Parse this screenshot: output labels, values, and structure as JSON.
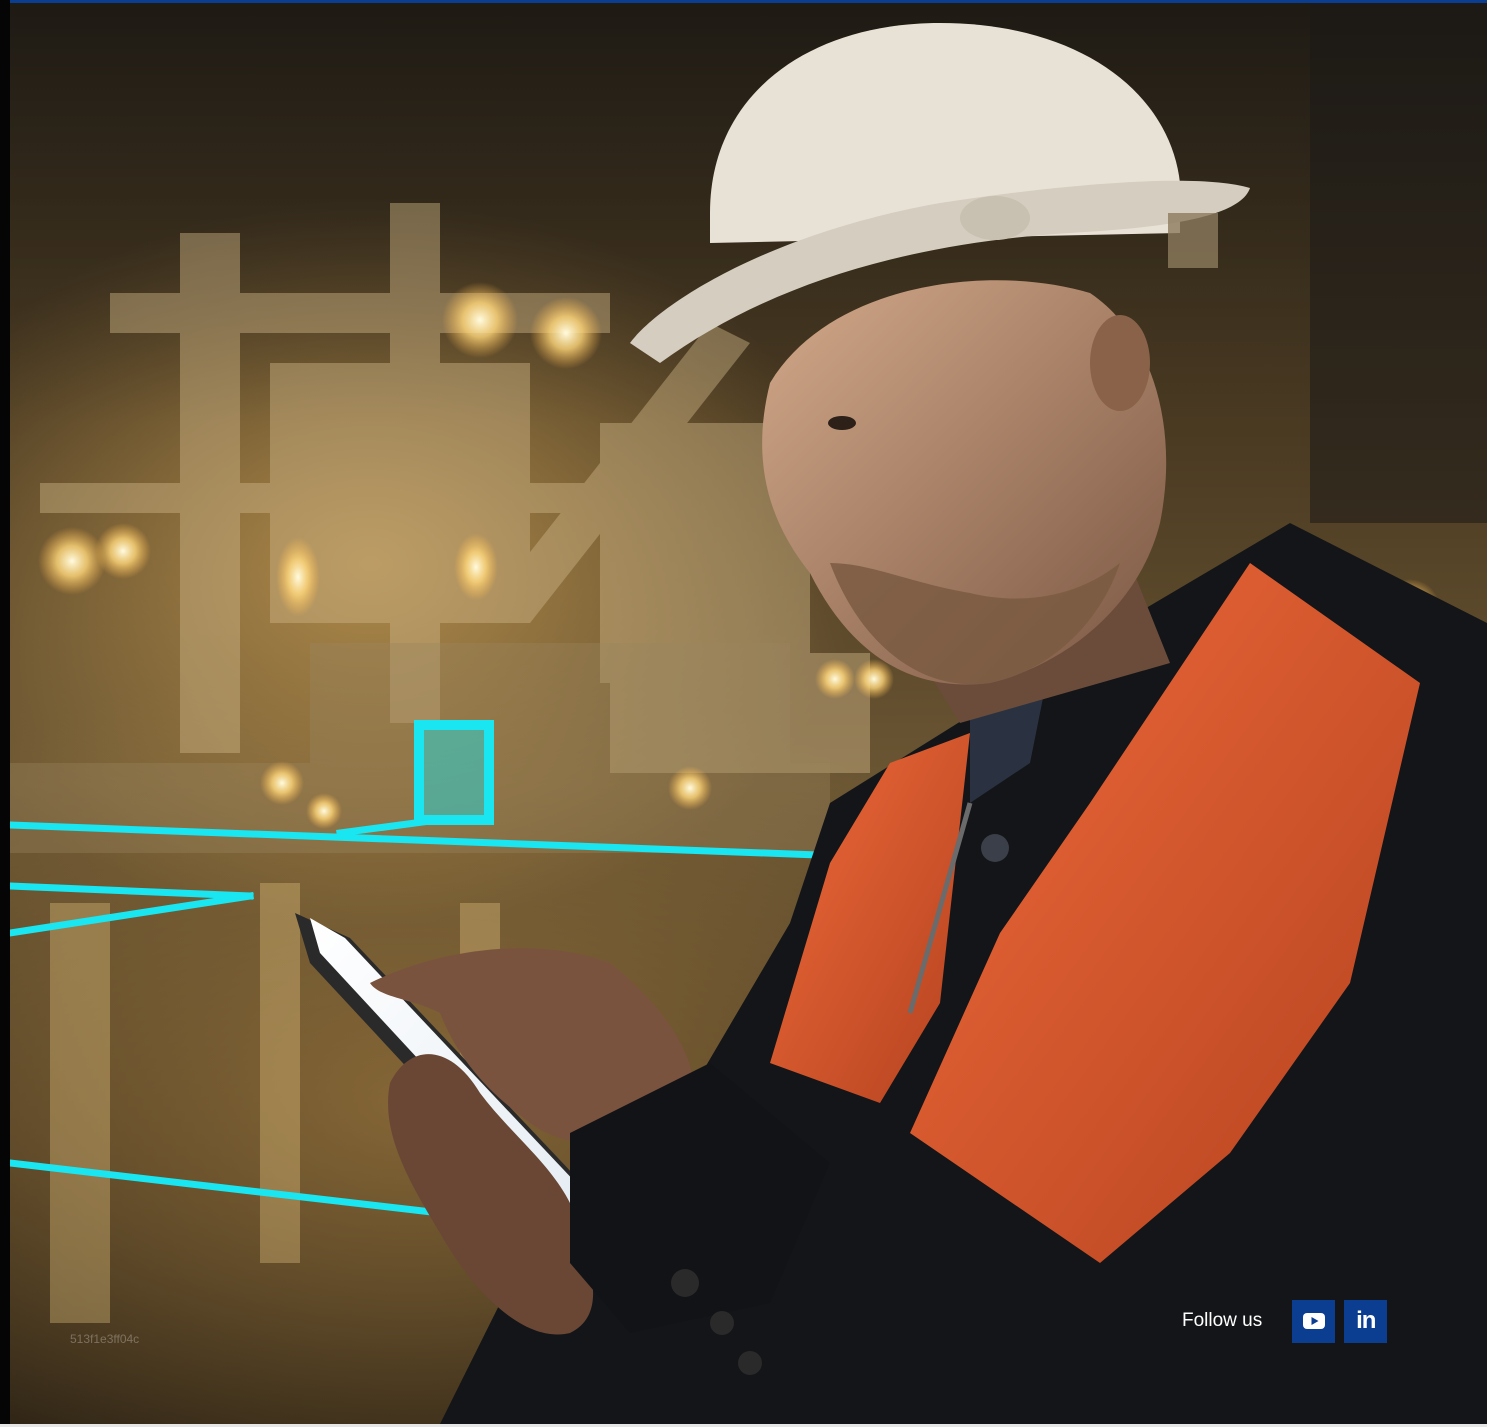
{
  "hero": {
    "image_description_icon": "worker-with-tablet-photo"
  },
  "footer": {
    "follow_label": "Follow us",
    "social": [
      {
        "name": "YouTube",
        "icon": "youtube-icon"
      },
      {
        "name": "LinkedIn",
        "icon": "linkedin-icon",
        "glyph": "in"
      }
    ],
    "id_text": "513f1e3ff04c"
  },
  "colors": {
    "brand": "#0b3d91",
    "accent_lines": "#19e6f0",
    "vest": "#d9532a",
    "helmet": "#e8e2d6"
  }
}
